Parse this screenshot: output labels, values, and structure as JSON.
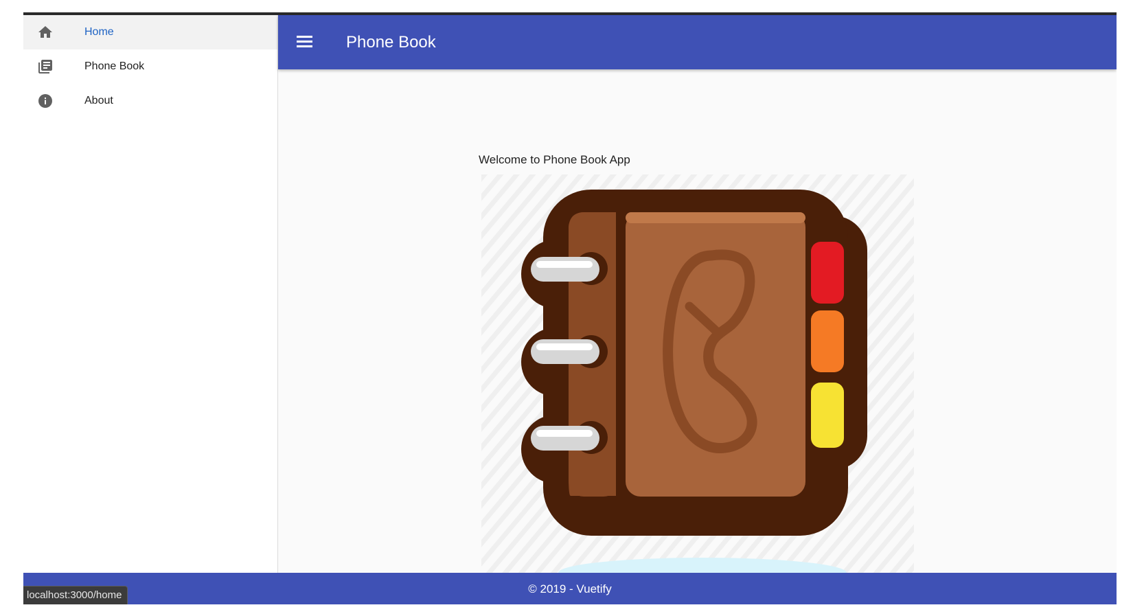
{
  "app": {
    "title": "Phone Book"
  },
  "sidebar": {
    "items": [
      {
        "label": "Home",
        "icon": "home-icon",
        "active": true
      },
      {
        "label": "Phone Book",
        "icon": "library-books-icon",
        "active": false
      },
      {
        "label": "About",
        "icon": "info-icon",
        "active": false
      }
    ]
  },
  "main": {
    "welcome_text": "Welcome to Phone Book App",
    "hero_image": "phone-book-illustration"
  },
  "footer": {
    "text": "© 2019 - Vuetify"
  },
  "status_bar": {
    "url": "localhost:3000/home"
  },
  "colors": {
    "primary": "#3f51b5",
    "active_link": "#1e63c4",
    "drawer_bg": "#ffffff",
    "content_bg": "#fafafa",
    "book_dark": "#4a1f08",
    "book_cover": "#a8643b",
    "tab_red": "#e31b23",
    "tab_orange": "#f57a25",
    "tab_yellow": "#f7e233"
  }
}
